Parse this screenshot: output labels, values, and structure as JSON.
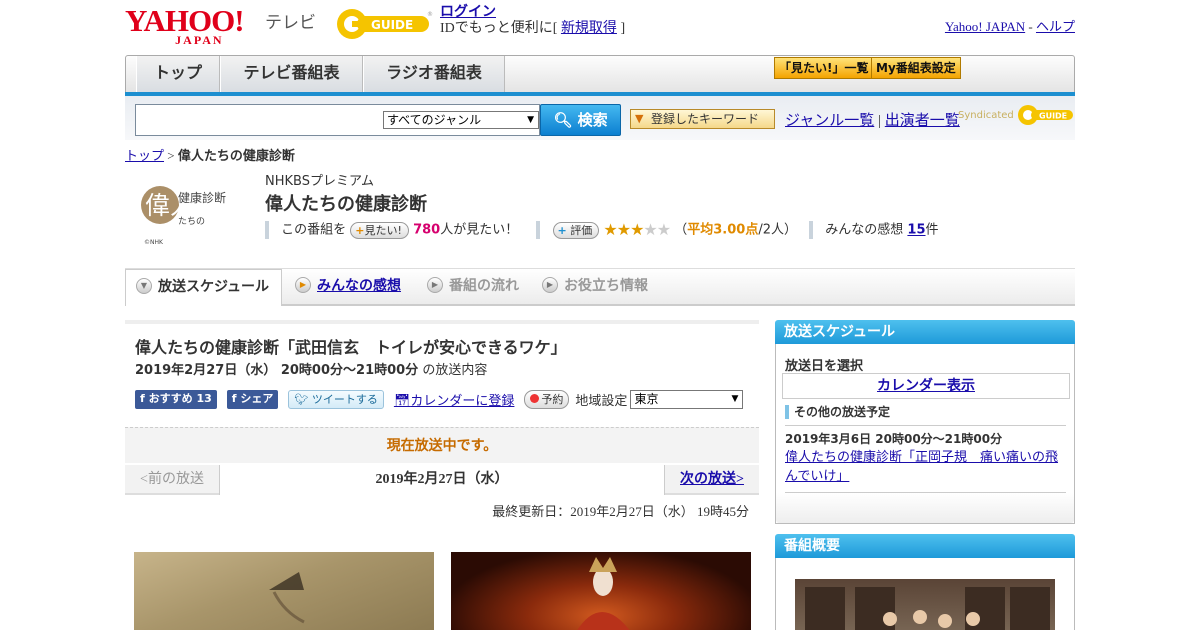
{
  "header": {
    "yahoo_logo": "YAHOO!",
    "yahoo_logo_sub": "JAPAN",
    "tv_label": "テレビ",
    "gguide_logo": "G-GUIDE",
    "login_link": "ログイン",
    "login_text": "IDでもっと便利に[",
    "register_link": "新規取得",
    "login_close": "]",
    "yahoo_japan_link": "Yahoo! JAPAN",
    "divider": "-",
    "help_link": "ヘルプ"
  },
  "gnav": {
    "tabs": [
      {
        "label": "トップ"
      },
      {
        "label": "テレビ番組表"
      },
      {
        "label": "ラジオ番組表"
      }
    ],
    "btn_mitai": "「見たい!」一覧",
    "btn_my": "My番組表設定"
  },
  "search": {
    "placeholder": "",
    "genre": "すべてのジャンル",
    "button": "検索",
    "keyword_button": "登録したキーワード",
    "genre_list": "ジャンル一覧",
    "sep": "|",
    "performer_list": "出演者一覧",
    "syndicated": "Syndicated"
  },
  "breadcrumb": {
    "top": "トップ",
    "sep": ">",
    "current": "偉人たちの健康診断"
  },
  "program": {
    "logo_text": "健康診断",
    "logo_big": "偉人",
    "logo_sub": "たちの",
    "logo_copy": "©NHK",
    "channel": "NHKBSプレミアム",
    "title": "偉人たちの健康診断",
    "want_prefix": "この番組を",
    "want_button": "見たい!",
    "want_count": "780",
    "want_suffix": "人が見たい！",
    "rate_button": "評価",
    "rating": 3,
    "rating_max": 5,
    "avg_open": "（",
    "avg_label": "平均3.00点",
    "avg_count": "/2人）",
    "reviews_label": "みんなの感想",
    "reviews_count": "15",
    "reviews_unit": "件"
  },
  "tabs": [
    {
      "label": "放送スケジュール",
      "state": "active"
    },
    {
      "label": "みんなの感想",
      "state": "link"
    },
    {
      "label": "番組の流れ",
      "state": "disabled"
    },
    {
      "label": "お役立ち情報",
      "state": "disabled"
    }
  ],
  "episode": {
    "title": "偉人たちの健康診断「武田信玄　トイレが安心できるワケ」",
    "datetime": "2019年2月27日（水）  20時00分～21時00分",
    "datetime_suffix": " の放送内容",
    "fb_recommend": "おすすめ 13",
    "fb_share": "シェア",
    "tweet": "ツイートする",
    "calendar": "カレンダーに登録",
    "reserve": "予約",
    "region_label": "地域設定",
    "region": "東京",
    "onair": "現在放送中です。",
    "prev": "<前の放送",
    "date": "2019年2月27日（水）",
    "next": "次の放送>",
    "updated": "最終更新日：2019年2月27日（水）  19時45分"
  },
  "sidebar": {
    "schedule_title": "放送スケジュール",
    "select_date": "放送日を選択",
    "calendar_button": "カレンダー表示",
    "other_heading": "その他の放送予定",
    "other_date": "2019年3月6日  20時00分～21時00分",
    "other_title": "偉人たちの健康診断「正岡子規　痛い痛いの飛んでいけ」",
    "overview_title": "番組概要"
  },
  "colors": {
    "accent_blue": "#1c8fd0",
    "yahoo_red": "#e0001a",
    "onair_orange": "#c66b00",
    "star": "#e09a00"
  }
}
